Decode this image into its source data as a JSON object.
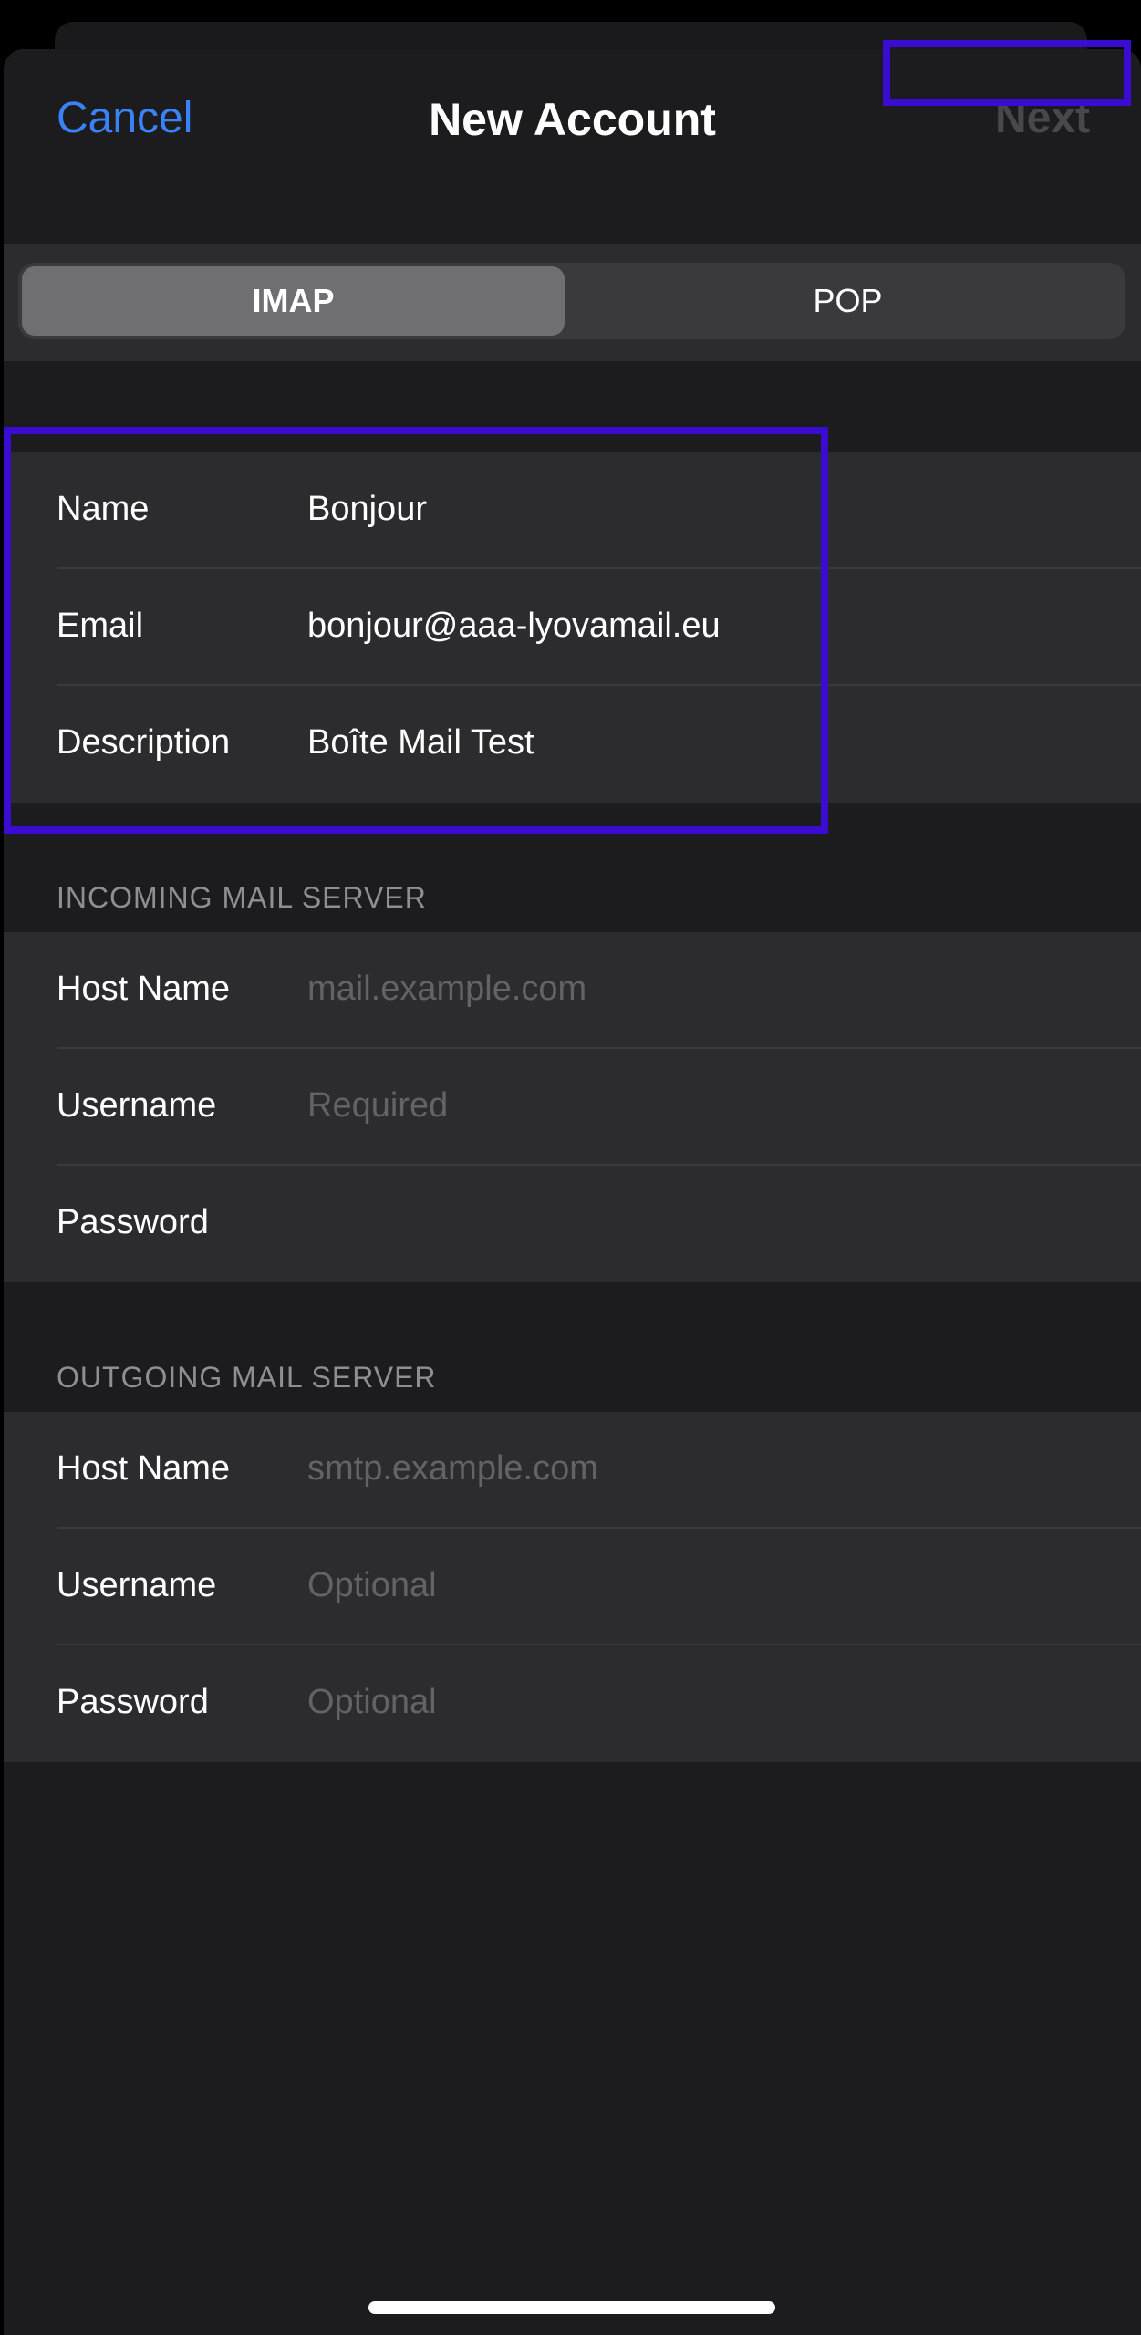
{
  "navbar": {
    "cancel_label": "Cancel",
    "title": "New Account",
    "next_label": "Next"
  },
  "segmented": {
    "options": [
      "IMAP",
      "POP"
    ],
    "selected": "IMAP"
  },
  "account": {
    "name_label": "Name",
    "name_value": "Bonjour",
    "email_label": "Email",
    "email_value": "bonjour@aaa-lyovamail.eu",
    "description_label": "Description",
    "description_value": "Boîte Mail Test"
  },
  "incoming": {
    "header": "INCOMING MAIL SERVER",
    "host_label": "Host Name",
    "host_placeholder": "mail.example.com",
    "username_label": "Username",
    "username_placeholder": "Required",
    "password_label": "Password",
    "password_placeholder": ""
  },
  "outgoing": {
    "header": "OUTGOING MAIL SERVER",
    "host_label": "Host Name",
    "host_placeholder": "smtp.example.com",
    "username_label": "Username",
    "username_placeholder": "Optional",
    "password_label": "Password",
    "password_placeholder": "Optional"
  },
  "colors": {
    "accent": "#3a82f7",
    "highlight": "#3a0bd1",
    "background": "#1c1c1e",
    "cell": "#2c2c2e"
  }
}
